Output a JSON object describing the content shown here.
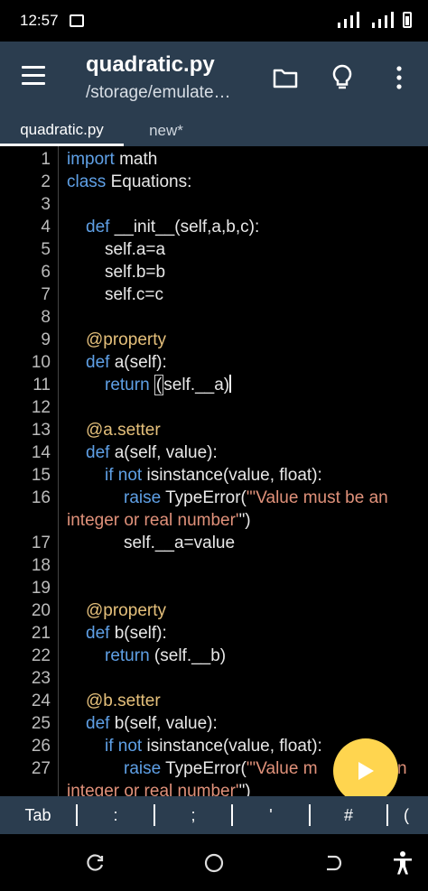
{
  "status": {
    "time": "12:57"
  },
  "app_bar": {
    "title": "quadratic.py",
    "subtitle": "/storage/emulate…"
  },
  "tabs": [
    {
      "label": "quadratic.py",
      "active": true
    },
    {
      "label": "new*",
      "active": false
    }
  ],
  "code_lines": [
    {
      "n": "1",
      "text": "import math"
    },
    {
      "n": "2",
      "text": "class Equations:"
    },
    {
      "n": "3",
      "text": ""
    },
    {
      "n": "4",
      "text": "    def __init__(self,a,b,c):"
    },
    {
      "n": "5",
      "text": "        self.a=a"
    },
    {
      "n": "6",
      "text": "        self.b=b"
    },
    {
      "n": "7",
      "text": "        self.c=c"
    },
    {
      "n": "8",
      "text": ""
    },
    {
      "n": "9",
      "text": "    @property"
    },
    {
      "n": "10",
      "text": "    def a(self):"
    },
    {
      "n": "11",
      "text": "        return (self.__a)"
    },
    {
      "n": "12",
      "text": ""
    },
    {
      "n": "13",
      "text": "    @a.setter"
    },
    {
      "n": "14",
      "text": "    def a(self, value):"
    },
    {
      "n": "15",
      "text": "        if not isinstance(value, float):"
    },
    {
      "n": "16",
      "text": "            raise TypeError('''Value must be an integer or real number''')"
    },
    {
      "n": "17",
      "text": "            self.__a=value"
    },
    {
      "n": "18",
      "text": ""
    },
    {
      "n": "19",
      "text": ""
    },
    {
      "n": "20",
      "text": "    @property"
    },
    {
      "n": "21",
      "text": "    def b(self):"
    },
    {
      "n": "22",
      "text": "        return (self.__b)"
    },
    {
      "n": "23",
      "text": ""
    },
    {
      "n": "24",
      "text": "    @b.setter"
    },
    {
      "n": "25",
      "text": "    def b(self, value):"
    },
    {
      "n": "26",
      "text": "        if not isinstance(value, float):"
    },
    {
      "n": "27",
      "text": "            raise TypeError('''Value must be an integer or real number''')"
    }
  ],
  "display": {
    "l16a": "raise TypeError(\"'Value must be an",
    "l16b": "integer or real number'\")",
    "l27a": "raise TypeError(\"'Value m",
    "l27b": "n",
    "l27c": "integer or real number'\")"
  },
  "symbols": [
    "Tab",
    ":",
    ";",
    "'",
    "#",
    "("
  ],
  "colors": {
    "app_bar": "#2b3d4f",
    "keyword": "#5fa0e6",
    "decorator": "#e5c07b",
    "string": "#e0917a",
    "fab": "#ffd54f"
  },
  "icons": [
    "menu-icon",
    "folder-icon",
    "lightbulb-icon",
    "more-vert-icon",
    "play-icon",
    "recents-icon",
    "home-icon",
    "back-icon",
    "accessibility-icon"
  ]
}
